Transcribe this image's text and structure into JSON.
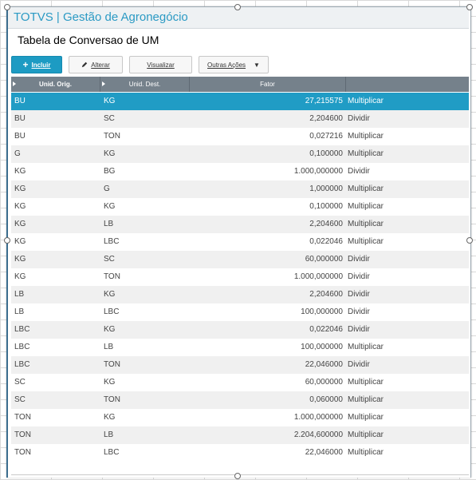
{
  "app": {
    "title": "TOTVS | Gestão de Agronegócio"
  },
  "page": {
    "title": "Tabela de Conversao de UM"
  },
  "toolbar": {
    "incluir_label": "Incluir",
    "alterar_label": "Alterar",
    "visualizar_label": "Visualizar",
    "outras_acoes_label": "Outras Ações"
  },
  "grid": {
    "columns": [
      "Unid. Orig.",
      "Unid. Dest.",
      "Fator"
    ],
    "selected_row": 0,
    "rows": [
      {
        "orig": "BU",
        "dest": "KG",
        "fator": "27,215575",
        "op": "Multiplicar"
      },
      {
        "orig": "BU",
        "dest": "SC",
        "fator": "2,204600",
        "op": "Dividir"
      },
      {
        "orig": "BU",
        "dest": "TON",
        "fator": "0,027216",
        "op": "Multiplicar"
      },
      {
        "orig": "G",
        "dest": "KG",
        "fator": "0,100000",
        "op": "Multiplicar"
      },
      {
        "orig": "KG",
        "dest": "BG",
        "fator": "1.000,000000",
        "op": "Dividir"
      },
      {
        "orig": "KG",
        "dest": "G",
        "fator": "1,000000",
        "op": "Multiplicar"
      },
      {
        "orig": "KG",
        "dest": "KG",
        "fator": "0,100000",
        "op": "Multiplicar"
      },
      {
        "orig": "KG",
        "dest": "LB",
        "fator": "2,204600",
        "op": "Multiplicar"
      },
      {
        "orig": "KG",
        "dest": "LBC",
        "fator": "0,022046",
        "op": "Multiplicar"
      },
      {
        "orig": "KG",
        "dest": "SC",
        "fator": "60,000000",
        "op": "Dividir"
      },
      {
        "orig": "KG",
        "dest": "TON",
        "fator": "1.000,000000",
        "op": "Dividir"
      },
      {
        "orig": "LB",
        "dest": "KG",
        "fator": "2,204600",
        "op": "Dividir"
      },
      {
        "orig": "LB",
        "dest": "LBC",
        "fator": "100,000000",
        "op": "Dividir"
      },
      {
        "orig": "LBC",
        "dest": "KG",
        "fator": "0,022046",
        "op": "Dividir"
      },
      {
        "orig": "LBC",
        "dest": "LB",
        "fator": "100,000000",
        "op": "Multiplicar"
      },
      {
        "orig": "LBC",
        "dest": "TON",
        "fator": "22,046000",
        "op": "Dividir"
      },
      {
        "orig": "SC",
        "dest": "KG",
        "fator": "60,000000",
        "op": "Multiplicar"
      },
      {
        "orig": "SC",
        "dest": "TON",
        "fator": "0,060000",
        "op": "Multiplicar"
      },
      {
        "orig": "TON",
        "dest": "KG",
        "fator": "1.000,000000",
        "op": "Multiplicar"
      },
      {
        "orig": "TON",
        "dest": "LB",
        "fator": "2.204,600000",
        "op": "Multiplicar"
      },
      {
        "orig": "TON",
        "dest": "LBC",
        "fator": "22,046000",
        "op": "Multiplicar"
      }
    ]
  },
  "colors": {
    "accent": "#1d9bc3",
    "header_bg": "#75818b",
    "title_color": "#2b9ac4"
  },
  "icons": {
    "incluir": "plus-icon",
    "alterar": "pencil-icon",
    "outras_acoes": "caret-down-icon"
  }
}
